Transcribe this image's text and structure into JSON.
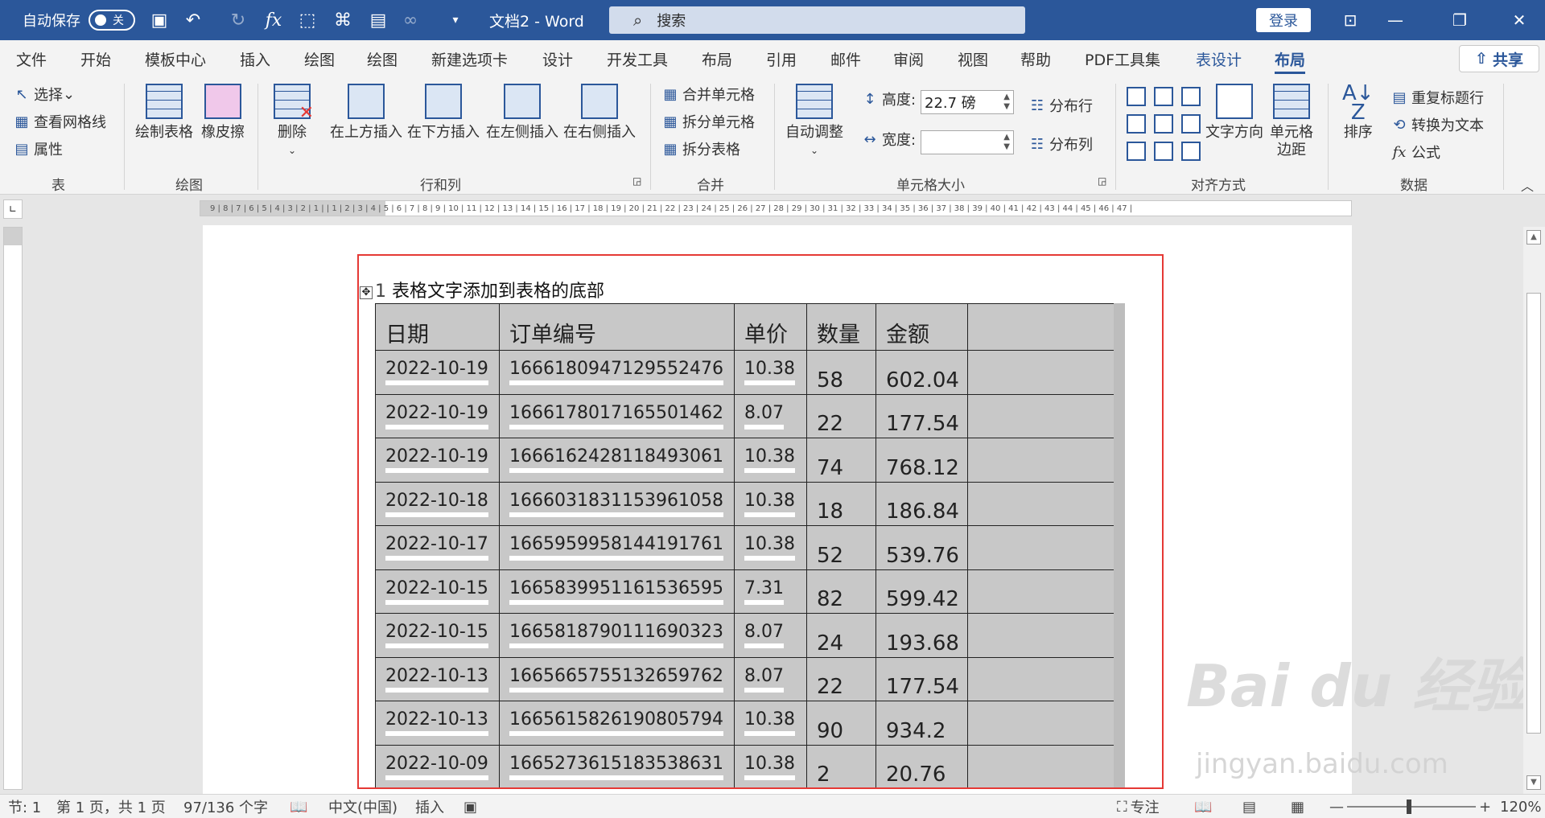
{
  "titlebar": {
    "autosave_label": "自动保存",
    "autosave_state": "关",
    "doc_title": "文档2  -  Word",
    "search_placeholder": "搜索",
    "login_label": "登录"
  },
  "tabs": [
    "文件",
    "开始",
    "模板中心",
    "插入",
    "绘图",
    "绘图",
    "新建选项卡",
    "设计",
    "开发工具",
    "布局",
    "引用",
    "邮件",
    "审阅",
    "视图",
    "帮助",
    "PDF工具集",
    "表设计",
    "布局"
  ],
  "share_label": "共享",
  "ribbon": {
    "table_group": {
      "select": "选择",
      "view_gridlines": "查看网格线",
      "properties": "属性",
      "label": "表"
    },
    "draw_group": {
      "draw_table": "绘制表格",
      "eraser": "橡皮擦",
      "label": "绘图"
    },
    "rows_cols": {
      "delete": "删除",
      "insert_above": "在上方插入",
      "insert_below": "在下方插入",
      "insert_left": "在左侧插入",
      "insert_right": "在右侧插入",
      "label": "行和列"
    },
    "merge": {
      "merge_cells": "合并单元格",
      "split_cells": "拆分单元格",
      "split_table": "拆分表格",
      "label": "合并"
    },
    "cell_size": {
      "autofit": "自动调整",
      "height_label": "高度:",
      "height_value": "22.7 磅",
      "width_label": "宽度:",
      "width_value": "",
      "distribute_rows": "分布行",
      "distribute_cols": "分布列",
      "label": "单元格大小"
    },
    "alignment": {
      "text_direction": "文字方向",
      "cell_margins_1": "单元格",
      "cell_margins_2": "边距",
      "label": "对齐方式"
    },
    "data": {
      "sort": "排序",
      "repeat_header": "重复标题行",
      "convert_text": "转换为文本",
      "formula": "公式",
      "label": "数据"
    }
  },
  "ruler_h": "9 | 8 | 7 | 6 | 5 | 4 | 3 | 2 | 1 |  | 1 | 2 | 3 | 4 | 5 | 6 | 7 | 8 | 9 | 10 | 11 | 12 | 13 | 14 | 15 | 16 | 17 | 18 | 19 | 20 | 21 | 22 | 23 | 24 | 25 | 26 | 27 | 28 | 29 | 30 | 31 | 32 | 33 | 34 | 35 | 36 | 37 | 38 | 39 | 40 | 41 | 42 | 43 | 44 | 45 | 46 | 47 |",
  "document": {
    "caption_num": "1",
    "caption_text": "表格文字添加到表格的底部",
    "headers": [
      "日期",
      "订单编号",
      "单价",
      "数量",
      "金额",
      ""
    ],
    "rows": [
      [
        "2022-10-19",
        "1666180947129552476",
        "10.38",
        "58",
        "602.04",
        ""
      ],
      [
        "2022-10-19",
        "1666178017165501462",
        "8.07",
        "22",
        "177.54",
        ""
      ],
      [
        "2022-10-19",
        "1666162428118493061",
        "10.38",
        "74",
        "768.12",
        ""
      ],
      [
        "2022-10-18",
        "1666031831153961058",
        "10.38",
        "18",
        "186.84",
        ""
      ],
      [
        "2022-10-17",
        "1665959958144191761",
        "10.38",
        "52",
        "539.76",
        ""
      ],
      [
        "2022-10-15",
        "1665839951161536595",
        "7.31",
        "82",
        "599.42",
        ""
      ],
      [
        "2022-10-15",
        "1665818790111690323",
        "8.07",
        "24",
        "193.68",
        ""
      ],
      [
        "2022-10-13",
        "1665665755132659762",
        "8.07",
        "22",
        "177.54",
        ""
      ],
      [
        "2022-10-13",
        "1665615826190805794",
        "10.38",
        "90",
        "934.2",
        ""
      ],
      [
        "2022-10-09",
        "1665273615183538631",
        "10.38",
        "2",
        "20.76",
        ""
      ]
    ]
  },
  "watermark": {
    "main": "Bai du 经验",
    "sub": "jingyan.baidu.com"
  },
  "status": {
    "section": "节: 1",
    "page": "第 1 页，共 1 页",
    "words": "97/136 个字",
    "language": "中文(中国)",
    "mode": "插入",
    "focus": "专注",
    "zoom": "120%"
  }
}
